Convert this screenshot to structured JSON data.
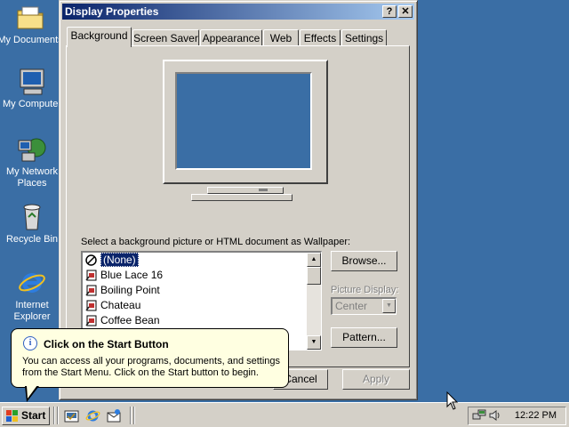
{
  "desktop": {
    "icons": [
      {
        "label": "My Documents",
        "icon": "folder-documents-icon"
      },
      {
        "label": "My Computer",
        "icon": "computer-icon"
      },
      {
        "label": "My Network Places",
        "icon": "network-icon"
      },
      {
        "label": "Recycle Bin",
        "icon": "recycle-bin-icon"
      },
      {
        "label": "Internet Explorer",
        "icon": "internet-explorer-icon"
      }
    ],
    "bg_color": "#3a6ea5"
  },
  "dialog": {
    "title": "Display Properties",
    "help_btn": "?",
    "close_btn": "✕",
    "tabs": [
      "Background",
      "Screen Saver",
      "Appearance",
      "Web",
      "Effects",
      "Settings"
    ],
    "active_tab": "Background",
    "wallpaper_label": "Select a background picture or HTML document as Wallpaper:",
    "wallpapers": [
      "(None)",
      "Blue Lace 16",
      "Boiling Point",
      "Chateau",
      "Coffee Bean"
    ],
    "selected_wallpaper": "(None)",
    "browse_label": "Browse...",
    "picture_display_label": "Picture Display:",
    "picture_display_value": "Center",
    "pattern_label": "Pattern...",
    "cancel_label": "Cancel",
    "apply_label": "Apply"
  },
  "balloon": {
    "title": "Click on the Start Button",
    "text": "You can access all your programs, documents, and settings from the Start Menu. Click on the Start button to begin.",
    "icon": "info-icon"
  },
  "taskbar": {
    "start_label": "Start",
    "quick_launch": [
      "show-desktop-icon",
      "internet-explorer-icon",
      "outlook-express-icon"
    ],
    "tray_icons": [
      "network-tray-icon",
      "volume-icon"
    ],
    "clock": "12:22 PM"
  }
}
